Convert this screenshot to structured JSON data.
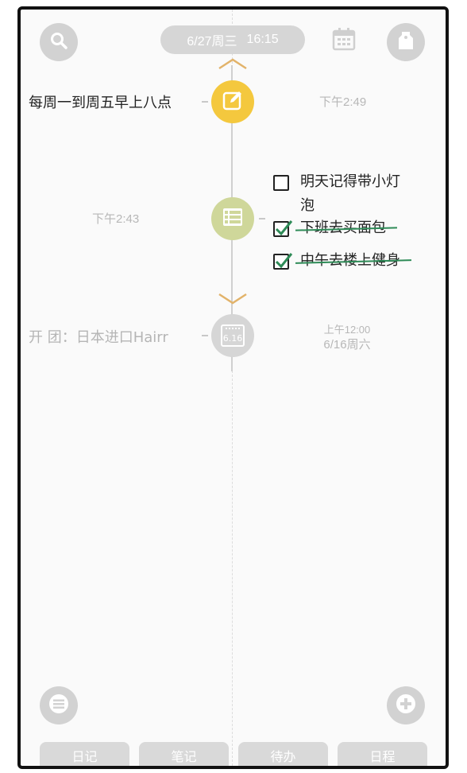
{
  "header": {
    "date_label": "6/27周三",
    "time_label": "16:15",
    "icons": [
      "search-icon",
      "calendar-icon",
      "tag-icon"
    ]
  },
  "timeline": {
    "entries": [
      {
        "type": "note",
        "icon": "edit-icon",
        "color": "#f4c83e",
        "text": "每周一到周五早上八点",
        "time": "下午2:49"
      },
      {
        "type": "todo-list",
        "icon": "list-icon",
        "color": "#cfd79a",
        "time": "下午2:43",
        "todos": [
          {
            "text_line1": "明天记得带小灯",
            "text_line2": "泡",
            "done": false
          },
          {
            "text": "下班去买面包",
            "done": true
          },
          {
            "text": "中午去楼上健身",
            "done": true
          }
        ]
      },
      {
        "type": "event",
        "icon": "calendar-date-icon",
        "date_badge": "6.16",
        "color": "#d6d6d6",
        "text": "开 团：日本进口Hairr",
        "time_line1": "上午12:00",
        "time_line2": "6/16周六"
      }
    ]
  },
  "bottom": {
    "menu_icon": "menu-icon",
    "add_icon": "plus-icon",
    "tabs": [
      "日记",
      "笔记",
      "待办",
      "日程"
    ]
  }
}
